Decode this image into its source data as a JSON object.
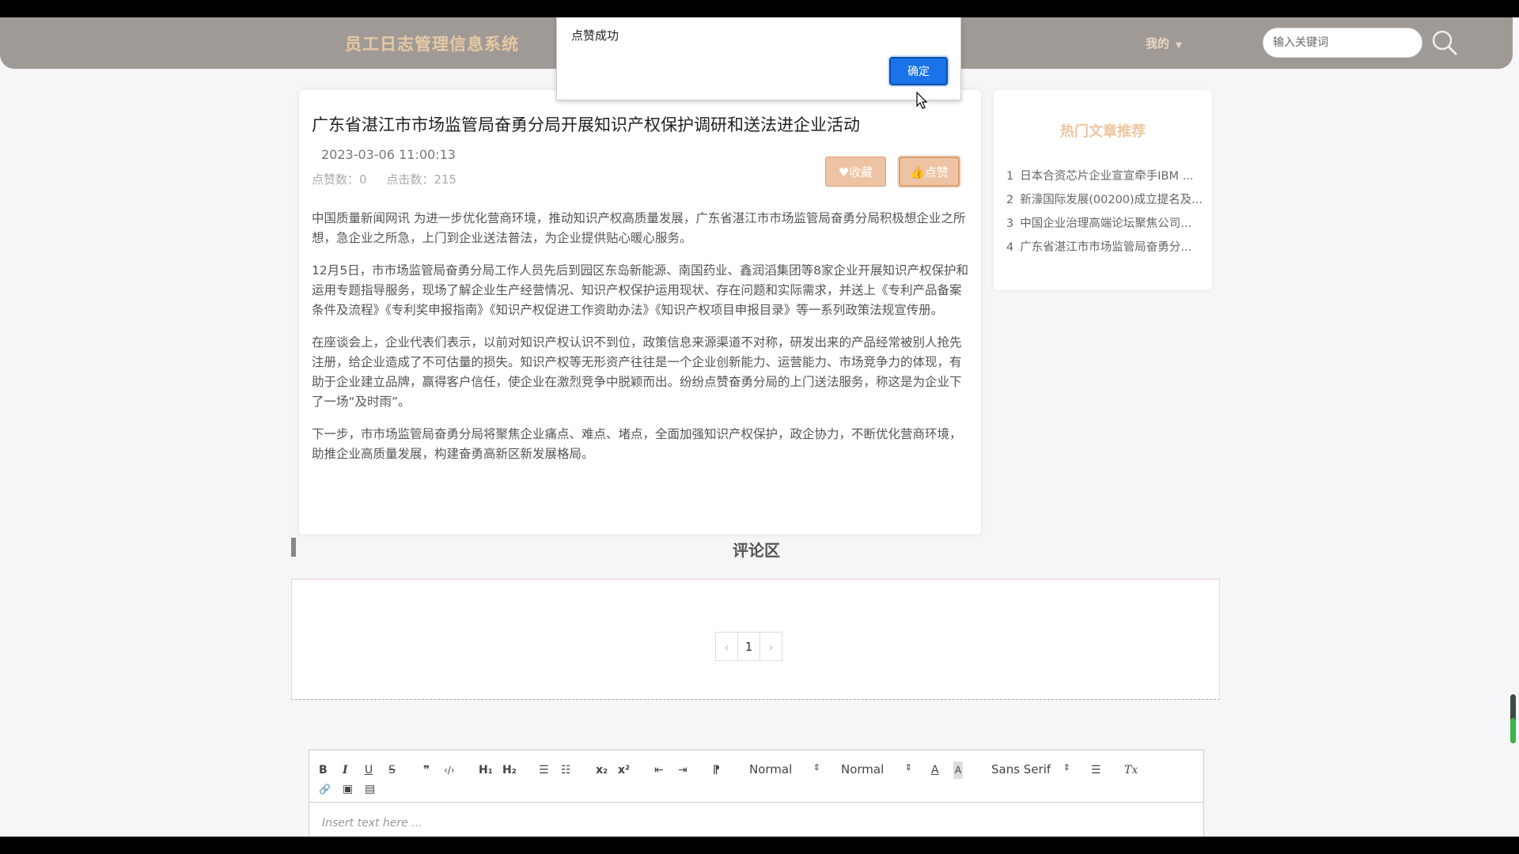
{
  "header": {
    "brand": "员工日志管理信息系统",
    "my_menu": "我的",
    "search_placeholder": "输入关键词"
  },
  "article": {
    "title": "广东省湛江市市场监管局奋勇分局开展知识产权保护调研和送法进企业活动",
    "date": "2023-03-06 11:00:13",
    "likes_label": "点赞数：0",
    "clicks_label": "点击数：215",
    "fav_button": "♥收藏",
    "like_button": "👍点赞",
    "paragraphs": [
      "中国质量新闻网讯 为进一步优化营商环境，推动知识产权高质量发展，广东省湛江市市场监管局奋勇分局积极想企业之所想，急企业之所急，上门到企业送法普法，为企业提供贴心暖心服务。",
      "12月5日，市市场监管局奋勇分局工作人员先后到园区东岛新能源、南国药业、鑫润滔集团等8家企业开展知识产权保护和运用专题指导服务，现场了解企业生产经营情况、知识产权保护运用现状、存在问题和实际需求，并送上《专利产品备案条件及流程》《专利奖申报指南》《知识产权促进工作资助办法》《知识产权项目申报目录》等一系列政策法规宣传册。",
      "在座谈会上，企业代表们表示，以前对知识产权认识不到位，政策信息来源渠道不对称，研发出来的产品经常被别人抢先注册，给企业造成了不可估量的损失。知识产权等无形资产往往是一个企业创新能力、运营能力、市场竞争力的体现，有助于企业建立品牌，赢得客户信任，使企业在激烈竞争中脱颖而出。纷纷点赞奋勇分局的上门送法服务，称这是为企业下了一场“及时雨”。",
      "下一步，市市场监管局奋勇分局将聚焦企业痛点、难点、堵点，全面加强知识产权保护，政企协力，不断优化营商环境，助推企业高质量发展，构建奋勇高新区新发展格局。"
    ]
  },
  "hot": {
    "title": "热门文章推荐",
    "items": [
      {
        "num": "1",
        "text": "日本合资芯片企业宣宣牵手IBM ..."
      },
      {
        "num": "2",
        "text": "新濠国际发展(00200)成立提名及..."
      },
      {
        "num": "3",
        "text": "中国企业治理高端论坛聚焦公司..."
      },
      {
        "num": "4",
        "text": "广东省湛江市市场监管局奋勇分..."
      }
    ]
  },
  "comments": {
    "heading": "评论区",
    "pager": {
      "prev": "‹",
      "page": "1",
      "next": "›"
    }
  },
  "editor": {
    "toolbar": {
      "bold": "B",
      "italic": "I",
      "underline": "U",
      "strike": "S",
      "quote": "❞",
      "code": "‹/›",
      "h1": "H₁",
      "h2": "H₂",
      "ol": "☰",
      "ul": "☷",
      "sub": "x₂",
      "sup": "x²",
      "outdent": "⇤",
      "indent": "⇥",
      "rtl": "⁋",
      "size": "Normal",
      "header": "Normal",
      "color": "A",
      "background": "A",
      "font": "Sans Serif",
      "align": "☰",
      "clean": "Tx",
      "link": "🔗",
      "image": "▣",
      "video": "▤"
    },
    "placeholder": "Insert text here ..."
  },
  "dialog": {
    "message": "点赞成功",
    "ok": "确定"
  },
  "colors": {
    "navbar": "#a09a97",
    "brand": "#e6c9a3",
    "accent": "#eec3a3",
    "dialog_button": "#1a73e8"
  }
}
